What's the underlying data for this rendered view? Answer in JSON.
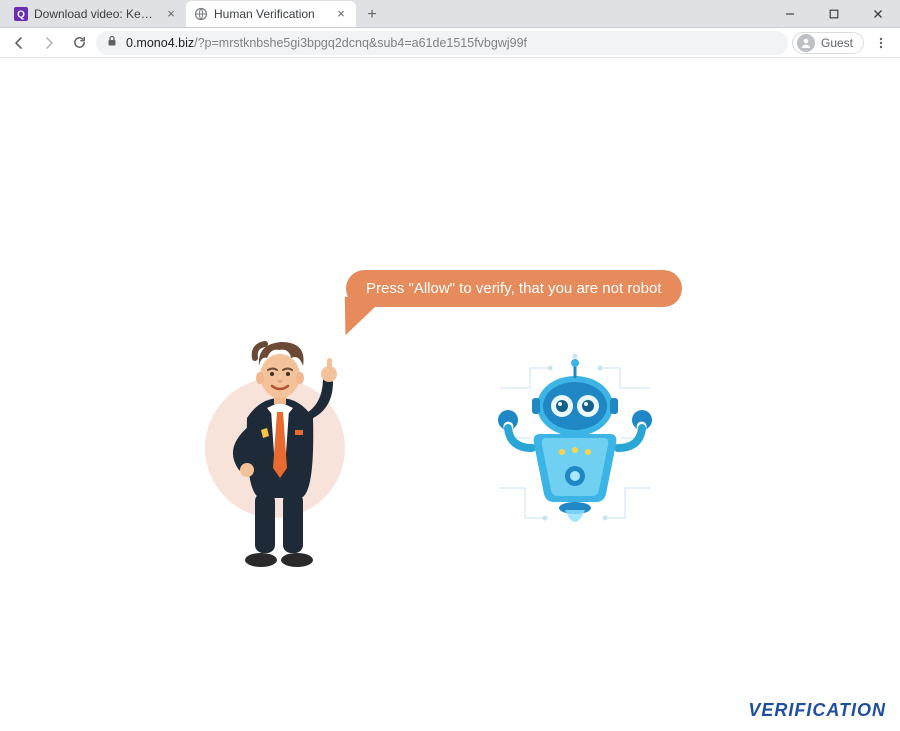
{
  "window": {
    "tabs": [
      {
        "title": "Download video: Keeping Summ…",
        "active": false,
        "favicon": "q-icon"
      },
      {
        "title": "Human Verification",
        "active": true,
        "favicon": "globe-icon"
      }
    ],
    "controls": {
      "min": "minimize",
      "max": "maximize",
      "close": "close"
    }
  },
  "toolbar": {
    "back_enabled": true,
    "forward_enabled": false,
    "url_host": "0.mono4.biz",
    "url_rest": "/?p=mrstknbshe5gi3bpgq2dcnq&sub4=a61de1515fvbgwj99f",
    "guest_label": "Guest"
  },
  "page": {
    "bubble_text": "Press \"Allow\" to verify, that you are not robot",
    "footer_text": "VERIFICATION"
  }
}
